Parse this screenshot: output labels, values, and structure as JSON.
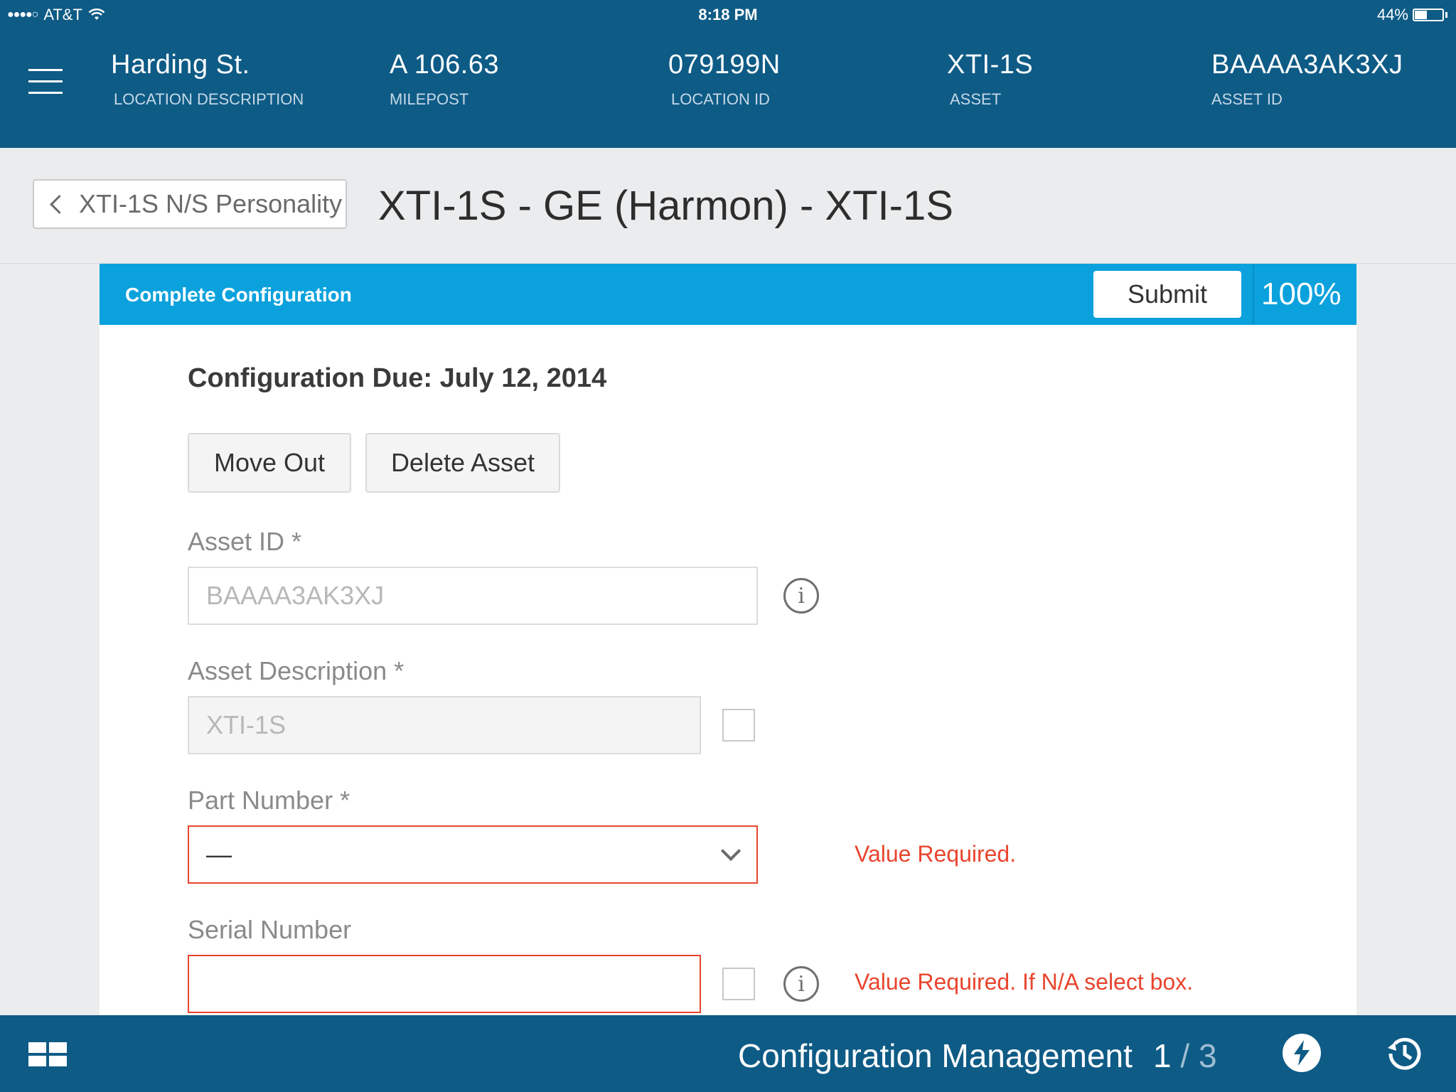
{
  "status_bar": {
    "signal": "●●●●○",
    "carrier": "AT&T",
    "time": "8:18 PM",
    "battery": "44%",
    "battery_level": 0.44
  },
  "header": {
    "location_description": {
      "value": "Harding St.",
      "label": "LOCATION DESCRIPTION"
    },
    "milepost": {
      "value": "A 106.63",
      "label": "MILEPOST"
    },
    "location_id": {
      "value": "079199N",
      "label": "LOCATION ID"
    },
    "asset": {
      "value": "XTI-1S",
      "label": "ASSET"
    },
    "asset_id": {
      "value": "BAAAA3AK3XJ",
      "label": "ASSET ID"
    }
  },
  "title_bar": {
    "back_label": "XTI-1S N/S Personality",
    "title": "XTI-1S - GE (Harmon) - XTI-1S"
  },
  "config_bar": {
    "title": "Complete Configuration",
    "submit_label": "Submit",
    "progress": "100%"
  },
  "form": {
    "due": "Configuration Due: July 12, 2014",
    "move_out_label": "Move Out",
    "delete_asset_label": "Delete Asset",
    "asset_id": {
      "label": "Asset ID *",
      "value": "BAAAA3AK3XJ"
    },
    "asset_description": {
      "label": "Asset Description *",
      "value": "XTI-1S"
    },
    "part_number": {
      "label": "Part Number *",
      "value": "—",
      "error": "Value Required."
    },
    "serial_number": {
      "label": "Serial Number",
      "value": "",
      "error": "Value Required. If N/A select box."
    }
  },
  "footer": {
    "title": "Configuration Management",
    "page_current": "1",
    "page_sep": " / ",
    "page_total": "3"
  },
  "icons": [
    "menu-icon",
    "chevron-left-icon",
    "info-icon",
    "chevron-down-icon",
    "grid-icon",
    "bolt-icon",
    "history-icon",
    "wifi-icon",
    "battery-icon"
  ],
  "colors": {
    "header_bg": "#0e5b86",
    "config_bar_bg": "#0aa1dd",
    "error": "#e8452e"
  }
}
